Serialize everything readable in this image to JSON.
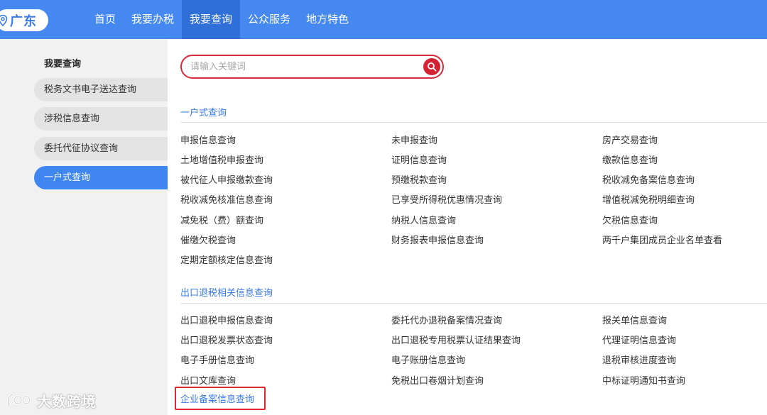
{
  "header": {
    "region": "广东",
    "nav": [
      {
        "label": "首页",
        "active": false
      },
      {
        "label": "我要办税",
        "active": false
      },
      {
        "label": "我要查询",
        "active": true
      },
      {
        "label": "公众服务",
        "active": false
      },
      {
        "label": "地方特色",
        "active": false
      }
    ]
  },
  "sidebar": {
    "title": "我要查询",
    "items": [
      {
        "label": "税务文书电子送达查询",
        "active": false
      },
      {
        "label": "涉税信息查询",
        "active": false
      },
      {
        "label": "委托代征协议查询",
        "active": false
      },
      {
        "label": "一户式查询",
        "active": true
      }
    ]
  },
  "search": {
    "placeholder": "请输入关键词",
    "value": ""
  },
  "sections": [
    {
      "title": "一户式查询",
      "links": [
        "申报信息查询",
        "未申报查询",
        "房产交易查询",
        "土地增值税申报查询",
        "证明信息查询",
        "缴款信息查询",
        "被代征人申报缴款查询",
        "预缴税款查询",
        "税收减免备案信息查询",
        "税收减免核准信息查询",
        "已享受所得税优惠情况查询",
        "增值税减免税明细查询",
        "减免税（费）额查询",
        "纳税人信息查询",
        "欠税信息查询",
        "催缴欠税查询",
        "财务报表申报信息查询",
        "两千户集团成员企业名单查看",
        "定期定额核定信息查询"
      ]
    },
    {
      "title": "出口退税相关信息查询",
      "links": [
        "出口退税申报信息查询",
        "委托代办退税备案情况查询",
        "报关单信息查询",
        "出口退税发票状态查询",
        "出口退税专用税票认证结果查询",
        "代理证明信息查询",
        "电子手册信息查询",
        "电子账册信息查询",
        "退税审核进度查询",
        "出口文库查询",
        "免税出口卷烟计划查询",
        "中标证明通知书查询"
      ],
      "highlighted_link": "企业备案信息查询"
    }
  ],
  "watermark": "大数跨境",
  "colors": {
    "nav_bg": "#4589f0",
    "nav_active": "#2e6fd8",
    "accent_blue": "#3a7be6",
    "highlight_red": "#e0262c"
  }
}
